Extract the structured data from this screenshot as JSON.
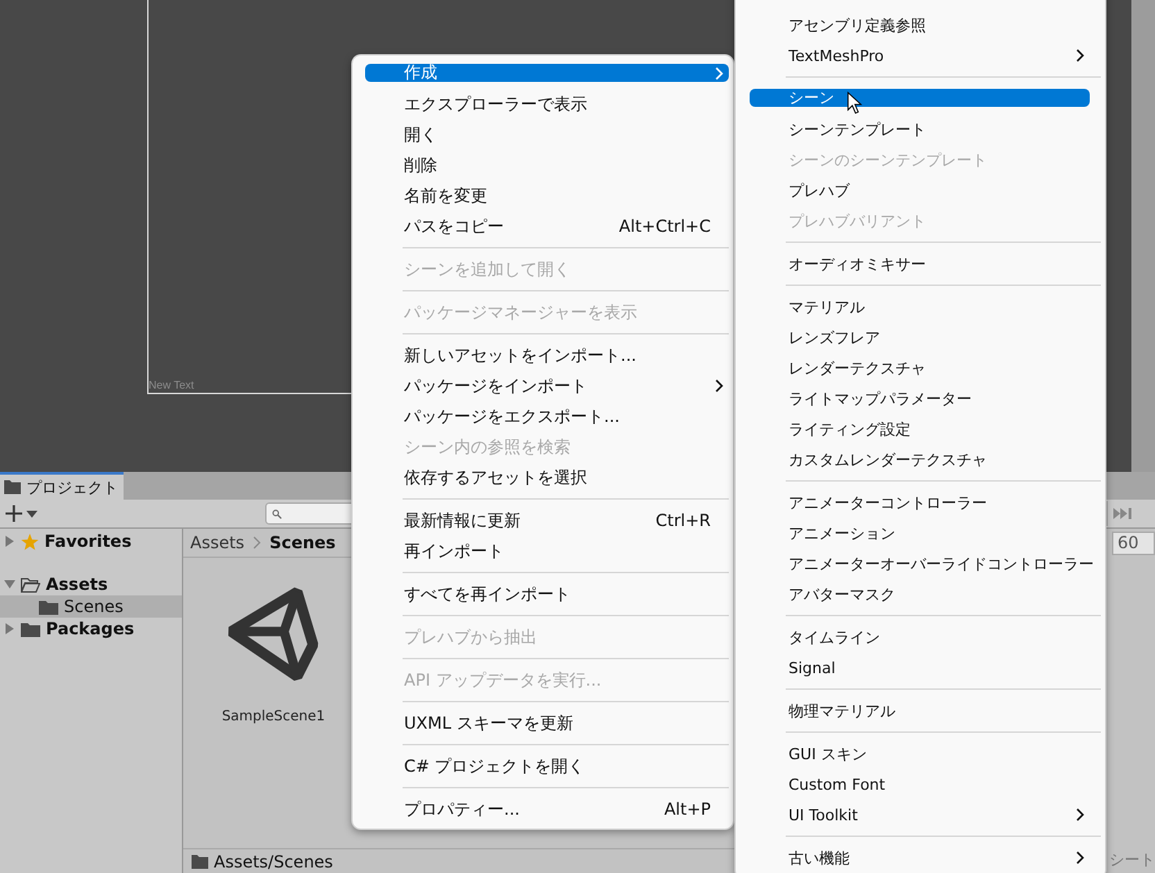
{
  "scene_view": {
    "label": "New Text"
  },
  "context_menu": {
    "items": [
      {
        "kind": "item",
        "label": "作成",
        "submenu": true,
        "disabled": false,
        "selected": true
      },
      {
        "kind": "item",
        "label": "エクスプローラーで表示",
        "disabled": false,
        "selected": false
      },
      {
        "kind": "item",
        "label": "開く",
        "disabled": false,
        "selected": false
      },
      {
        "kind": "item",
        "label": "削除",
        "disabled": false,
        "selected": false
      },
      {
        "kind": "item",
        "label": "名前を変更",
        "disabled": false,
        "selected": false
      },
      {
        "kind": "item",
        "label": "パスをコピー",
        "shortcut": "Alt+Ctrl+C",
        "disabled": false,
        "selected": false
      },
      {
        "kind": "separator"
      },
      {
        "kind": "item",
        "label": "シーンを追加して開く",
        "disabled": true,
        "selected": false
      },
      {
        "kind": "separator"
      },
      {
        "kind": "item",
        "label": "パッケージマネージャーを表示",
        "disabled": true,
        "selected": false
      },
      {
        "kind": "separator"
      },
      {
        "kind": "item",
        "label": "新しいアセットをインポート...",
        "disabled": false,
        "selected": false
      },
      {
        "kind": "item",
        "label": "パッケージをインポート",
        "submenu": true,
        "disabled": false,
        "selected": false
      },
      {
        "kind": "item",
        "label": "パッケージをエクスポート...",
        "disabled": false,
        "selected": false
      },
      {
        "kind": "item",
        "label": "シーン内の参照を検索",
        "disabled": true,
        "selected": false
      },
      {
        "kind": "item",
        "label": "依存するアセットを選択",
        "disabled": false,
        "selected": false
      },
      {
        "kind": "separator"
      },
      {
        "kind": "item",
        "label": "最新情報に更新",
        "shortcut": "Ctrl+R",
        "disabled": false,
        "selected": false
      },
      {
        "kind": "item",
        "label": "再インポート",
        "disabled": false,
        "selected": false
      },
      {
        "kind": "separator"
      },
      {
        "kind": "item",
        "label": "すべてを再インポート",
        "disabled": false,
        "selected": false
      },
      {
        "kind": "separator"
      },
      {
        "kind": "item",
        "label": "プレハブから抽出",
        "disabled": true,
        "selected": false
      },
      {
        "kind": "separator"
      },
      {
        "kind": "item",
        "label": "API アップデータを実行...",
        "disabled": true,
        "selected": false
      },
      {
        "kind": "separator"
      },
      {
        "kind": "item",
        "label": "UXML スキーマを更新",
        "disabled": false,
        "selected": false
      },
      {
        "kind": "separator"
      },
      {
        "kind": "item",
        "label": "C# プロジェクトを開く",
        "disabled": false,
        "selected": false
      },
      {
        "kind": "separator"
      },
      {
        "kind": "item",
        "label": "プロパティー...",
        "shortcut": "Alt+P",
        "disabled": false,
        "selected": false
      }
    ]
  },
  "submenu": {
    "items": [
      {
        "kind": "item",
        "label": "アセンブリ定義参照",
        "disabled": false,
        "selected": false
      },
      {
        "kind": "item",
        "label": "TextMeshPro",
        "submenu": true,
        "disabled": false,
        "selected": false
      },
      {
        "kind": "separator"
      },
      {
        "kind": "item",
        "label": "シーン",
        "disabled": false,
        "selected": true
      },
      {
        "kind": "item",
        "label": "シーンテンプレート",
        "disabled": false,
        "selected": false
      },
      {
        "kind": "item",
        "label": "シーンのシーンテンプレート",
        "disabled": true,
        "selected": false
      },
      {
        "kind": "item",
        "label": "プレハブ",
        "disabled": false,
        "selected": false
      },
      {
        "kind": "item",
        "label": "プレハブバリアント",
        "disabled": true,
        "selected": false
      },
      {
        "kind": "separator"
      },
      {
        "kind": "item",
        "label": "オーディオミキサー",
        "disabled": false,
        "selected": false
      },
      {
        "kind": "separator"
      },
      {
        "kind": "item",
        "label": "マテリアル",
        "disabled": false,
        "selected": false
      },
      {
        "kind": "item",
        "label": "レンズフレア",
        "disabled": false,
        "selected": false
      },
      {
        "kind": "item",
        "label": "レンダーテクスチャ",
        "disabled": false,
        "selected": false
      },
      {
        "kind": "item",
        "label": "ライトマップパラメーター",
        "disabled": false,
        "selected": false
      },
      {
        "kind": "item",
        "label": "ライティング設定",
        "disabled": false,
        "selected": false
      },
      {
        "kind": "item",
        "label": "カスタムレンダーテクスチャ",
        "disabled": false,
        "selected": false
      },
      {
        "kind": "separator"
      },
      {
        "kind": "item",
        "label": "アニメーターコントローラー",
        "disabled": false,
        "selected": false
      },
      {
        "kind": "item",
        "label": "アニメーション",
        "disabled": false,
        "selected": false
      },
      {
        "kind": "item",
        "label": "アニメーターオーバーライドコントローラー",
        "disabled": false,
        "selected": false
      },
      {
        "kind": "item",
        "label": "アバターマスク",
        "disabled": false,
        "selected": false
      },
      {
        "kind": "separator"
      },
      {
        "kind": "item",
        "label": "タイムライン",
        "disabled": false,
        "selected": false
      },
      {
        "kind": "item",
        "label": "Signal",
        "disabled": false,
        "selected": false
      },
      {
        "kind": "separator"
      },
      {
        "kind": "item",
        "label": "物理マテリアル",
        "disabled": false,
        "selected": false
      },
      {
        "kind": "separator"
      },
      {
        "kind": "item",
        "label": "GUI スキン",
        "disabled": false,
        "selected": false
      },
      {
        "kind": "item",
        "label": "Custom Font",
        "disabled": false,
        "selected": false
      },
      {
        "kind": "item",
        "label": "UI Toolkit",
        "submenu": true,
        "disabled": false,
        "selected": false
      },
      {
        "kind": "separator"
      },
      {
        "kind": "item",
        "label": "古い機能",
        "submenu": true,
        "disabled": false,
        "selected": false
      }
    ]
  },
  "project_panel": {
    "tab": {
      "label": "プロジェクト",
      "selected": true
    },
    "tree": [
      {
        "label": "Favorites",
        "expanded": false,
        "selected": false
      },
      {
        "label": "Assets",
        "expanded": true,
        "selected": false,
        "children": [
          {
            "label": "Scenes",
            "selected": true
          }
        ]
      },
      {
        "label": "Packages",
        "expanded": false,
        "selected": false
      }
    ],
    "breadcrumb": [
      "Assets",
      "Scenes"
    ],
    "assets": [
      {
        "name": "SampleScene1"
      }
    ],
    "status_path": "Assets/Scenes"
  },
  "side_panel": {
    "frame_field": "60",
    "tab_label": "シート"
  }
}
